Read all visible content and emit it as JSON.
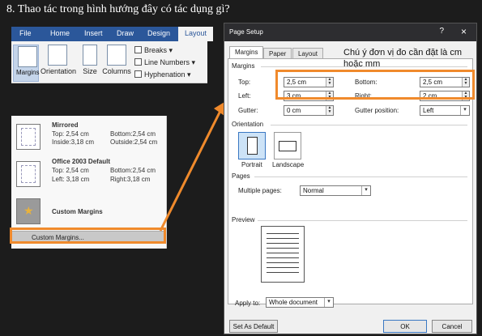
{
  "question": "8. Thao tác trong hình hướng đây có tác dụng gì?",
  "ribbon": {
    "tabs": [
      "File",
      "Home",
      "Insert",
      "Draw",
      "Design",
      "Layout"
    ],
    "buttons": [
      "Margins",
      "Orientation",
      "Size",
      "Columns"
    ],
    "small": [
      "Breaks",
      "Line Numbers",
      "Hyphenation"
    ]
  },
  "margins_menu": {
    "mirrored": {
      "title": "Mirrored",
      "top": "Top:   2,54 cm",
      "bottom": "Bottom:2,54 cm",
      "inside": "Inside:3,18 cm",
      "outside": "Outside:2,54 cm"
    },
    "office2003": {
      "title": "Office 2003 Default",
      "top": "Top:   2,54 cm",
      "bottom": "Bottom:2,54 cm",
      "left": "Left:   3,18 cm",
      "right": "Right:3,18 cm"
    },
    "custom_title": "Custom Margins",
    "custom_item": "Custom Margins..."
  },
  "dialog": {
    "title": "Page Setup",
    "help": "?",
    "close": "×",
    "tabs": [
      "Margins",
      "Paper",
      "Layout"
    ],
    "margins_group": "Margins",
    "top_label": "Top:",
    "top_value": "2,5 cm",
    "bottom_label": "Bottom:",
    "bottom_value": "2,5 cm",
    "left_label": "Left:",
    "left_value": "3 cm",
    "right_label": "Right:",
    "right_value": "2 cm",
    "gutter_label": "Gutter:",
    "gutter_value": "0 cm",
    "gutter_pos_label": "Gutter position:",
    "gutter_pos_value": "Left",
    "orientation_group": "Orientation",
    "portrait": "Portrait",
    "landscape": "Landscape",
    "pages_group": "Pages",
    "multiple_pages_label": "Multiple pages:",
    "multiple_pages_value": "Normal",
    "preview_group": "Preview",
    "apply_to_label": "Apply to:",
    "apply_to_value": "Whole document",
    "set_default": "Set As Default",
    "ok": "OK",
    "cancel": "Cancel"
  },
  "annotation": {
    "note": "Chú ý đơn vị đo cần đặt là cm hoặc mm",
    "color": "#f08a2c"
  }
}
